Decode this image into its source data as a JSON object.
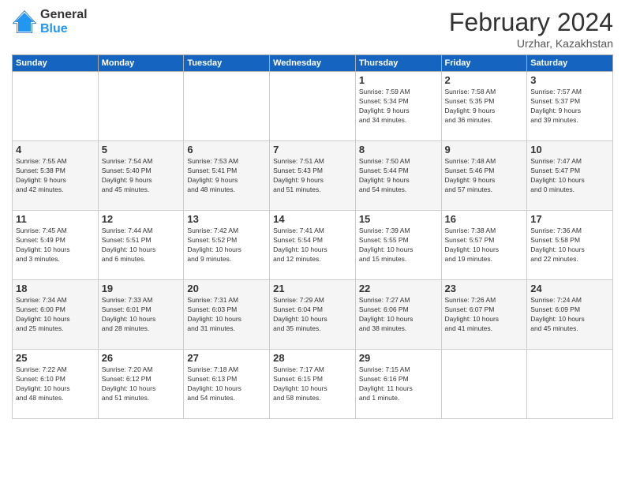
{
  "header": {
    "logo_general": "General",
    "logo_blue": "Blue",
    "month_title": "February 2024",
    "location": "Urzhar, Kazakhstan"
  },
  "weekdays": [
    "Sunday",
    "Monday",
    "Tuesday",
    "Wednesday",
    "Thursday",
    "Friday",
    "Saturday"
  ],
  "weeks": [
    [
      {
        "day": "",
        "info": ""
      },
      {
        "day": "",
        "info": ""
      },
      {
        "day": "",
        "info": ""
      },
      {
        "day": "",
        "info": ""
      },
      {
        "day": "1",
        "info": "Sunrise: 7:59 AM\nSunset: 5:34 PM\nDaylight: 9 hours\nand 34 minutes."
      },
      {
        "day": "2",
        "info": "Sunrise: 7:58 AM\nSunset: 5:35 PM\nDaylight: 9 hours\nand 36 minutes."
      },
      {
        "day": "3",
        "info": "Sunrise: 7:57 AM\nSunset: 5:37 PM\nDaylight: 9 hours\nand 39 minutes."
      }
    ],
    [
      {
        "day": "4",
        "info": "Sunrise: 7:55 AM\nSunset: 5:38 PM\nDaylight: 9 hours\nand 42 minutes."
      },
      {
        "day": "5",
        "info": "Sunrise: 7:54 AM\nSunset: 5:40 PM\nDaylight: 9 hours\nand 45 minutes."
      },
      {
        "day": "6",
        "info": "Sunrise: 7:53 AM\nSunset: 5:41 PM\nDaylight: 9 hours\nand 48 minutes."
      },
      {
        "day": "7",
        "info": "Sunrise: 7:51 AM\nSunset: 5:43 PM\nDaylight: 9 hours\nand 51 minutes."
      },
      {
        "day": "8",
        "info": "Sunrise: 7:50 AM\nSunset: 5:44 PM\nDaylight: 9 hours\nand 54 minutes."
      },
      {
        "day": "9",
        "info": "Sunrise: 7:48 AM\nSunset: 5:46 PM\nDaylight: 9 hours\nand 57 minutes."
      },
      {
        "day": "10",
        "info": "Sunrise: 7:47 AM\nSunset: 5:47 PM\nDaylight: 10 hours\nand 0 minutes."
      }
    ],
    [
      {
        "day": "11",
        "info": "Sunrise: 7:45 AM\nSunset: 5:49 PM\nDaylight: 10 hours\nand 3 minutes."
      },
      {
        "day": "12",
        "info": "Sunrise: 7:44 AM\nSunset: 5:51 PM\nDaylight: 10 hours\nand 6 minutes."
      },
      {
        "day": "13",
        "info": "Sunrise: 7:42 AM\nSunset: 5:52 PM\nDaylight: 10 hours\nand 9 minutes."
      },
      {
        "day": "14",
        "info": "Sunrise: 7:41 AM\nSunset: 5:54 PM\nDaylight: 10 hours\nand 12 minutes."
      },
      {
        "day": "15",
        "info": "Sunrise: 7:39 AM\nSunset: 5:55 PM\nDaylight: 10 hours\nand 15 minutes."
      },
      {
        "day": "16",
        "info": "Sunrise: 7:38 AM\nSunset: 5:57 PM\nDaylight: 10 hours\nand 19 minutes."
      },
      {
        "day": "17",
        "info": "Sunrise: 7:36 AM\nSunset: 5:58 PM\nDaylight: 10 hours\nand 22 minutes."
      }
    ],
    [
      {
        "day": "18",
        "info": "Sunrise: 7:34 AM\nSunset: 6:00 PM\nDaylight: 10 hours\nand 25 minutes."
      },
      {
        "day": "19",
        "info": "Sunrise: 7:33 AM\nSunset: 6:01 PM\nDaylight: 10 hours\nand 28 minutes."
      },
      {
        "day": "20",
        "info": "Sunrise: 7:31 AM\nSunset: 6:03 PM\nDaylight: 10 hours\nand 31 minutes."
      },
      {
        "day": "21",
        "info": "Sunrise: 7:29 AM\nSunset: 6:04 PM\nDaylight: 10 hours\nand 35 minutes."
      },
      {
        "day": "22",
        "info": "Sunrise: 7:27 AM\nSunset: 6:06 PM\nDaylight: 10 hours\nand 38 minutes."
      },
      {
        "day": "23",
        "info": "Sunrise: 7:26 AM\nSunset: 6:07 PM\nDaylight: 10 hours\nand 41 minutes."
      },
      {
        "day": "24",
        "info": "Sunrise: 7:24 AM\nSunset: 6:09 PM\nDaylight: 10 hours\nand 45 minutes."
      }
    ],
    [
      {
        "day": "25",
        "info": "Sunrise: 7:22 AM\nSunset: 6:10 PM\nDaylight: 10 hours\nand 48 minutes."
      },
      {
        "day": "26",
        "info": "Sunrise: 7:20 AM\nSunset: 6:12 PM\nDaylight: 10 hours\nand 51 minutes."
      },
      {
        "day": "27",
        "info": "Sunrise: 7:18 AM\nSunset: 6:13 PM\nDaylight: 10 hours\nand 54 minutes."
      },
      {
        "day": "28",
        "info": "Sunrise: 7:17 AM\nSunset: 6:15 PM\nDaylight: 10 hours\nand 58 minutes."
      },
      {
        "day": "29",
        "info": "Sunrise: 7:15 AM\nSunset: 6:16 PM\nDaylight: 11 hours\nand 1 minute."
      },
      {
        "day": "",
        "info": ""
      },
      {
        "day": "",
        "info": ""
      }
    ]
  ]
}
